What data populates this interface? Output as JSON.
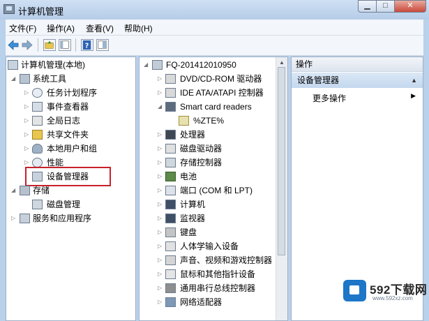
{
  "window": {
    "title": "计算机管理"
  },
  "menu": [
    "文件(F)",
    "操作(A)",
    "查看(V)",
    "帮助(H)"
  ],
  "tree": {
    "root": "计算机管理(本地)",
    "system_tools": "系统工具",
    "task_scheduler": "任务计划程序",
    "event_viewer": "事件查看器",
    "global_log": "全局日志",
    "shared_folders": "共享文件夹",
    "local_users": "本地用户和组",
    "performance": "性能",
    "device_manager": "设备管理器",
    "storage": "存储",
    "disk_management": "磁盘管理",
    "services_apps": "服务和应用程序"
  },
  "devices": {
    "computer": "FQ-201412010950",
    "items": [
      "DVD/CD-ROM 驱动器",
      "IDE ATA/ATAPI 控制器",
      "Smart card readers",
      "%ZTE%",
      "处理器",
      "磁盘驱动器",
      "存储控制器",
      "电池",
      "端口 (COM 和 LPT)",
      "计算机",
      "监视器",
      "键盘",
      "人体学输入设备",
      "声音、视频和游戏控制器",
      "鼠标和其他指针设备",
      "通用串行总线控制器",
      "网络适配器"
    ]
  },
  "actions": {
    "header": "操作",
    "selected": "设备管理器",
    "more": "更多操作"
  },
  "watermark": {
    "brand": "592下载网",
    "url": "www.592xz.com"
  },
  "colors": {
    "highlight_border": "#c8202a",
    "window_frame": "#b9d1ea"
  }
}
